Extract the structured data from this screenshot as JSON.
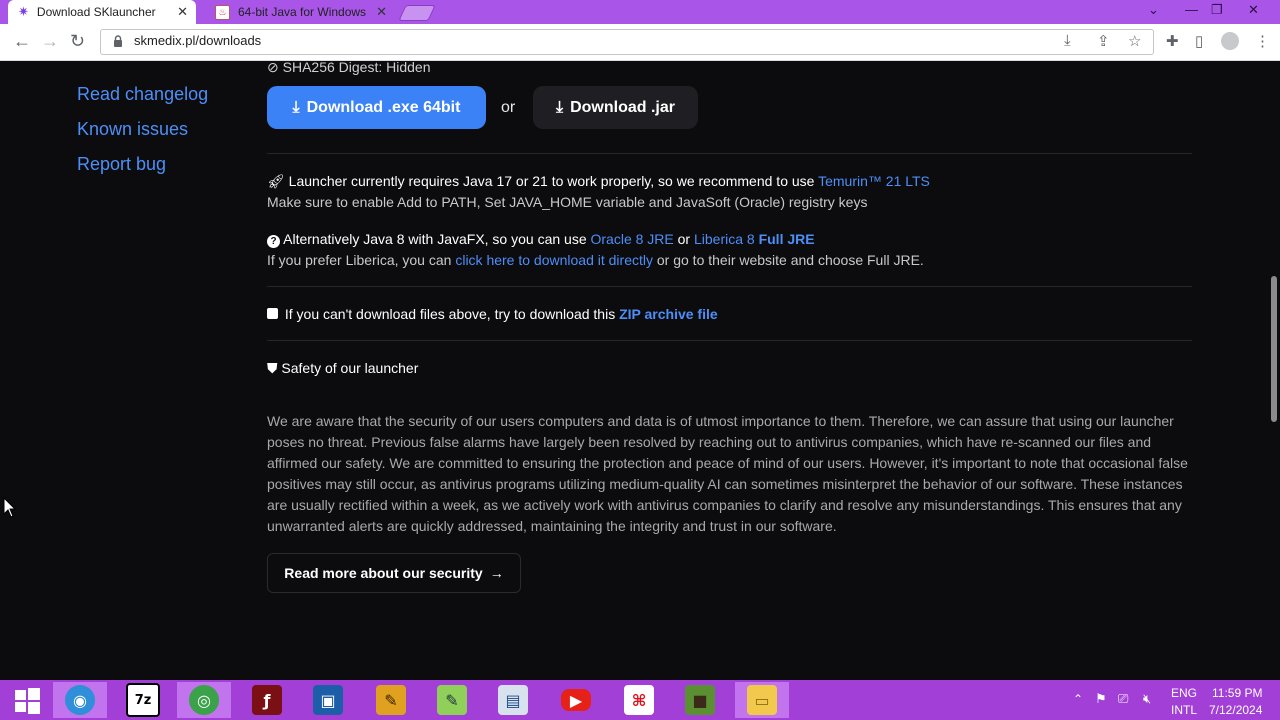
{
  "browser": {
    "tabs": [
      {
        "title": "Download SKlauncher",
        "close": "✕"
      },
      {
        "title": "64-bit Java for Windows",
        "close": "✕"
      }
    ],
    "url": "skmedix.pl/downloads",
    "window_controls": {
      "dropdown": "⌄",
      "minimize": "—",
      "maximize": "❐",
      "close": "✕"
    }
  },
  "sidebar": {
    "links": [
      "Read changelog",
      "Known issues",
      "Report bug"
    ]
  },
  "download": {
    "sha_label": "SHA256 Digest: Hidden",
    "exe_label": "Download .exe 64bit",
    "or_label": "or",
    "jar_label": "Download .jar"
  },
  "java_info": {
    "line1_text": "Launcher currently requires Java 17 or 21 to work properly, so we recommend to use",
    "line1_link": "Temurin™ 21 LTS",
    "line2": "Make sure to enable Add to PATH, Set JAVA_HOME variable and JavaSoft (Oracle) registry keys",
    "alt_text": "Alternatively Java 8 with JavaFX, so you can use",
    "alt_link1": "Oracle 8 JRE",
    "alt_or": "or",
    "alt_link2": "Liberica 8",
    "alt_link2_bold": "Full JRE",
    "liberica_text1": "If you prefer Liberica, you can",
    "liberica_link": "click here to download it directly",
    "liberica_text2": "or go to their website and choose Full JRE."
  },
  "zip": {
    "text": "If you can't download files above, try to download this",
    "link": "ZIP archive file"
  },
  "safety": {
    "heading": "Safety of our launcher",
    "paragraph": "We are aware that the security of our users computers and data is of utmost importance to them. Therefore, we can assure that using our launcher poses no threat. Previous false alarms have largely been resolved by reaching out to antivirus companies, which have re-scanned our files and affirmed our safety. We are committed to ensuring the protection and peace of mind of our users. However, it's important to note that occasional false positives may still occur, as antivirus programs utilizing medium-quality AI can sometimes misinterpret the behavior of our software. These instances are usually rectified within a week, as we actively work with antivirus companies to clarify and resolve any misunderstandings. This ensures that any unwarranted alerts are quickly addressed, maintaining the integrity and trust in our software.",
    "button": "Read more about our security",
    "button_arrow": "→"
  },
  "taskbar": {
    "apps": [
      {
        "name": "start",
        "glyph": ""
      },
      {
        "name": "browser-globe",
        "glyph": "◉"
      },
      {
        "name": "7zip",
        "glyph": "7z"
      },
      {
        "name": "network-globe",
        "glyph": "◎"
      },
      {
        "name": "flash",
        "glyph": "ƒ"
      },
      {
        "name": "virtualbox",
        "glyph": "▣"
      },
      {
        "name": "pen-tool",
        "glyph": "✎"
      },
      {
        "name": "notepad",
        "glyph": "✎"
      },
      {
        "name": "installer",
        "glyph": "▤"
      },
      {
        "name": "youtube",
        "glyph": "▶"
      },
      {
        "name": "pdf",
        "glyph": "⌘"
      },
      {
        "name": "minecraft",
        "glyph": "■"
      },
      {
        "name": "file-explorer",
        "glyph": "▭"
      }
    ],
    "lang_top": "ENG",
    "lang_bottom": "INTL",
    "time": "11:59 PM",
    "date": "7/12/2024"
  },
  "colors": {
    "tabbar": "#a855e8",
    "taskbar": "#a23fd6",
    "link": "#4d8ff7",
    "primary_button": "#3b82f6",
    "page_bg": "#0c0b0e"
  }
}
